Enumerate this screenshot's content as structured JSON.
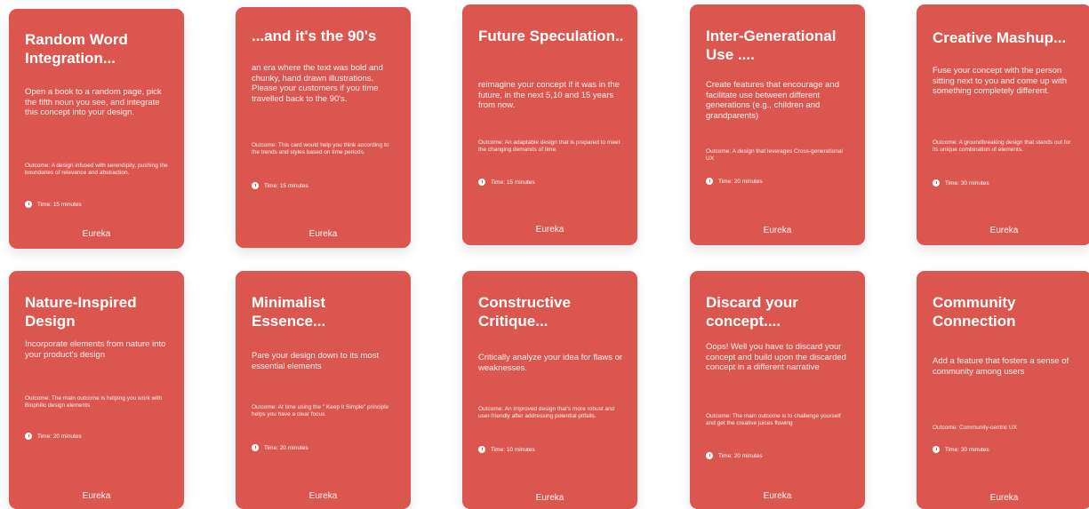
{
  "brand": "Eureka",
  "cards": [
    {
      "title": "Random Word Integration...",
      "description": "Open a book to a random page, pick the fifth noun you see, and integrate this concept into your design.",
      "outcome": "Outcome: A design infused with serendipity, pushing the boundaries of relevance and abstraction.",
      "time": "Time: 15 minutes"
    },
    {
      "title": "...and it's the 90's",
      "description": "an era where the text was bold and chunky, hand drawn illustrations. Please your customers if you time travelled back to the 90's.",
      "outcome": "Outcome: This card would help you think according to the trends and styles based on time periods.",
      "time": "Time: 15 minutes"
    },
    {
      "title": "Future Speculation..",
      "description": "reimagine your concept if it was in the future, in the next 5,10 and 15 years from now.",
      "outcome": "Outcome: An adaptable design that is prepared to meet the changing demands of time.",
      "time": "Time: 15 minutes"
    },
    {
      "title": "Inter-Generational Use ....",
      "description": "Create features that encourage and facilitate use between different generations (e.g., children and grandparents)",
      "outcome": "Outcome: A design that leverages Cross-generational UX",
      "time": "Time: 20 minutes"
    },
    {
      "title": "Creative Mashup...",
      "description": "Fuse your concept with the person sitting next to you and come up with something completely different.",
      "outcome": "Outcome: A groundbreaking design that stands out for its unique combination of elements.",
      "time": "Time: 30 minutes"
    },
    {
      "title": "Nature-Inspired Design",
      "description": "Incorporate elements from nature into your product's design",
      "outcome": "Outcome: The main outcome is helping you work with Biophilic design elements",
      "time": "Time: 20 minutes"
    },
    {
      "title": "Minimalist Essence...",
      "description": "Pare your design down to its most essential elements",
      "outcome": "Outcome: At time using the \" Keep it Simple\" principle helps you have a clear focus",
      "time": "Time: 20 minutes"
    },
    {
      "title": "Constructive Critique...",
      "description": "Critically analyze your idea for flaws or weaknesses.",
      "outcome": "Outcome: An improved design that's more robust and user-friendly after addressing potential pitfalls.",
      "time": "Time: 10 minutes"
    },
    {
      "title": "Discard your concept....",
      "description": "Oops! Well you have to discard your concept and build upon the discarded concept in a different narrative",
      "outcome": "Outcome: The main outcome is to challenge yourself and get the creative juices flowing",
      "time": "Time: 20 minutes"
    },
    {
      "title": "Community Connection",
      "description": "Add a feature that fosters a sense of community among users",
      "outcome": "Outcome: Community-centric UX",
      "time": "Time: 30 minutes"
    }
  ]
}
